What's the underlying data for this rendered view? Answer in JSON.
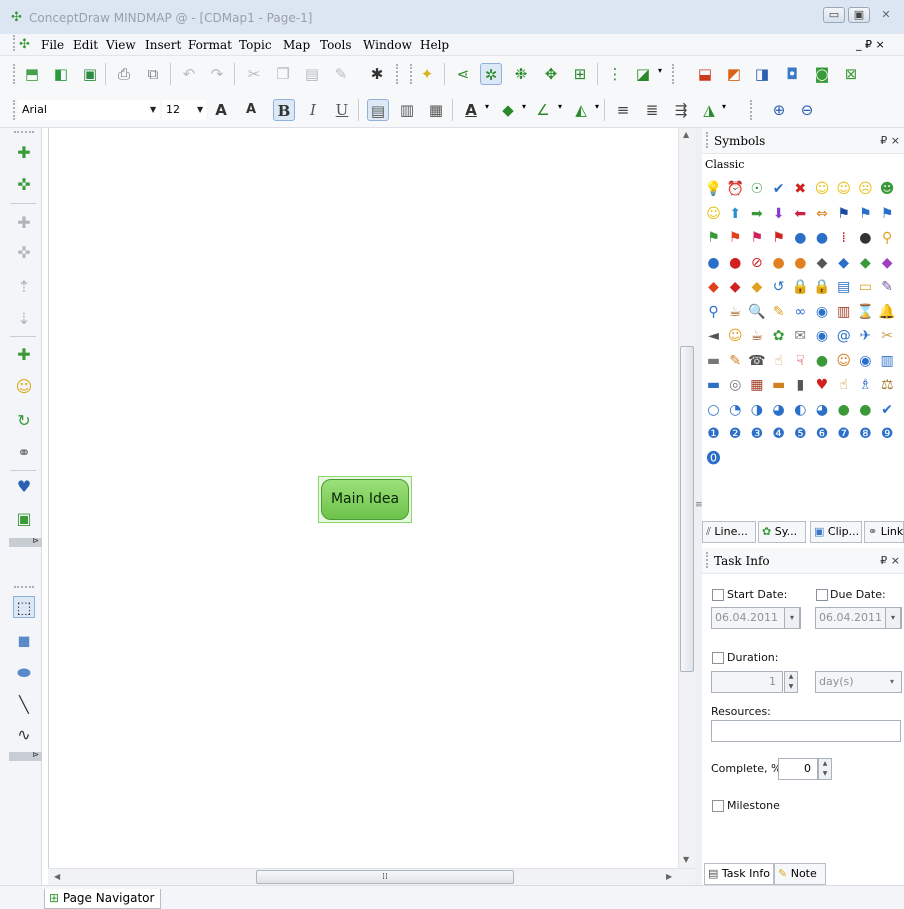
{
  "window": {
    "title": "ConceptDraw MINDMAP @ - [CDMap1 - Page-1]",
    "minimize": "▭",
    "maximize": "▣",
    "close": "✕"
  },
  "menu": {
    "items": [
      "File",
      "Edit",
      "View",
      "Insert",
      "Format",
      "Topic",
      "Map",
      "Tools",
      "Window",
      "Help"
    ],
    "mdi_controls": "_ ₽ ×"
  },
  "format_toolbar": {
    "font": "Arial",
    "size": "12"
  },
  "canvas": {
    "main_topic": "Main Idea"
  },
  "status": {
    "page_navigator": "Page Navigator"
  },
  "symbols_panel": {
    "title": "Symbols",
    "pin": "₽ ×",
    "library": "Classic",
    "tabs": [
      "Line...",
      "Sy...",
      "Clip...",
      "Link"
    ]
  },
  "task_info_panel": {
    "title": "Task Info",
    "pin": "₽ ×",
    "start_date_label": "Start Date:",
    "due_date_label": "Due Date:",
    "start_date": "06.04.2011",
    "due_date": "06.04.2011",
    "duration_label": "Duration:",
    "duration_value": "1",
    "duration_unit": "day(s)",
    "resources_label": "Resources:",
    "complete_label": "Complete, %:",
    "complete_value": "0",
    "milestone_label": "Milestone",
    "tabs": [
      "Task Info",
      "Note"
    ]
  }
}
